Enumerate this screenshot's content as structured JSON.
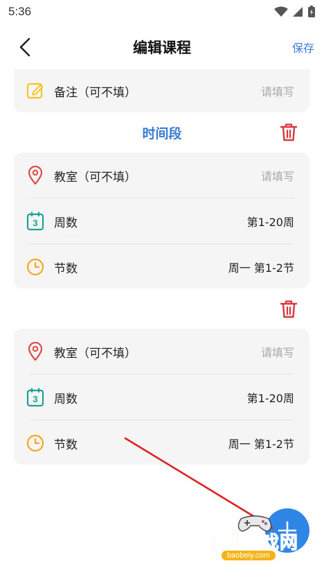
{
  "status_bar": {
    "time": "5:36"
  },
  "header": {
    "title": "编辑课程",
    "save_label": "保存"
  },
  "note_row": {
    "label": "备注（可不填）",
    "value": "请填写"
  },
  "section": {
    "title": "时间段"
  },
  "time_slots": [
    {
      "classroom": {
        "label": "教室（可不填）",
        "value": "请填写"
      },
      "weeks": {
        "label": "周数",
        "value": "第1-20周"
      },
      "periods": {
        "label": "节数",
        "value": "周一 第1-2节"
      }
    },
    {
      "classroom": {
        "label": "教室（可不填）",
        "value": "请填写"
      },
      "weeks": {
        "label": "周数",
        "value": "第1-20周"
      },
      "periods": {
        "label": "节数",
        "value": "周一 第1-2节"
      }
    }
  ],
  "watermark": {
    "text": "宝贝游戏网",
    "url": "baobeiy.com"
  },
  "colors": {
    "accent": "#3a7bd5",
    "danger": "#d9363e",
    "card_bg": "#f5f5f5",
    "fab": "#2f86e6",
    "icon_note": "#f5c326",
    "icon_location": "#e04848",
    "icon_calendar": "#1aa198",
    "icon_clock": "#f5a623"
  },
  "icons": {
    "back": "chevron-left-icon",
    "note": "edit-note-icon",
    "location": "location-pin-icon",
    "calendar": "calendar-icon",
    "clock": "clock-icon",
    "trash": "trash-icon",
    "add": "plus-icon"
  },
  "calendar_icon_number": "3"
}
